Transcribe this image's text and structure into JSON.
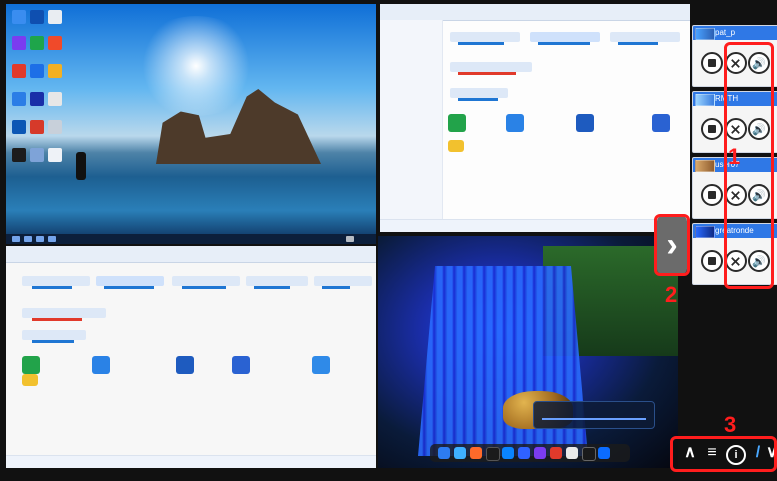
{
  "wall": {
    "quadrants": [
      {
        "name": "top-left",
        "content": "desktop"
      },
      {
        "name": "top-right",
        "content": "file-explorer"
      },
      {
        "name": "bottom-left",
        "content": "file-explorer"
      },
      {
        "name": "bottom-right",
        "content": "media"
      }
    ]
  },
  "sources_panel": {
    "items": [
      {
        "label": "pat_p"
      },
      {
        "label": "RMTH"
      },
      {
        "label": "user07"
      },
      {
        "label": "greatronde"
      }
    ],
    "buttons": [
      "stop",
      "close",
      "volume"
    ]
  },
  "navigation": {
    "chevron_symbol": "›"
  },
  "bottom_toolbar": {
    "buttons": [
      {
        "symbol": "∧",
        "name": "up"
      },
      {
        "symbol": "≡",
        "name": "menu"
      },
      {
        "symbol": "i",
        "name": "info"
      },
      {
        "symbol": "/",
        "name": "pen"
      },
      {
        "symbol": "∨",
        "name": "down"
      }
    ]
  },
  "annotations": [
    {
      "label": "1",
      "color": "#ff1d1d"
    },
    {
      "label": "2",
      "color": "#ff1d1d"
    },
    {
      "label": "3",
      "color": "#ff1d1d"
    }
  ]
}
